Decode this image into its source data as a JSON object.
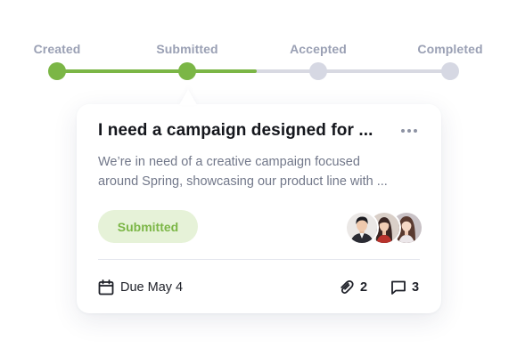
{
  "tracker": {
    "steps": [
      {
        "label": "Created",
        "state": "done"
      },
      {
        "label": "Submitted",
        "state": "current"
      },
      {
        "label": "Accepted",
        "state": "pending"
      },
      {
        "label": "Completed",
        "state": "pending"
      }
    ]
  },
  "card": {
    "title": "I need a campaign designed for ...",
    "description_lines": [
      "We’re in need of a creative campaign focused",
      "around Spring, showcasing our product line with ..."
    ],
    "status": "Submitted",
    "due": "Due May 4",
    "attachments_count": "2",
    "comments_count": "3",
    "more_icon": "ellipsis-icon",
    "due_icon": "calendar-icon",
    "attach_icon": "paperclip-icon",
    "comments_icon": "comment-icon"
  },
  "colors": {
    "accent_green": "#7bb646",
    "badge_bg": "#e6f2d8",
    "track_gray": "#d8d9e2",
    "label_gray": "#9aa0b4"
  }
}
